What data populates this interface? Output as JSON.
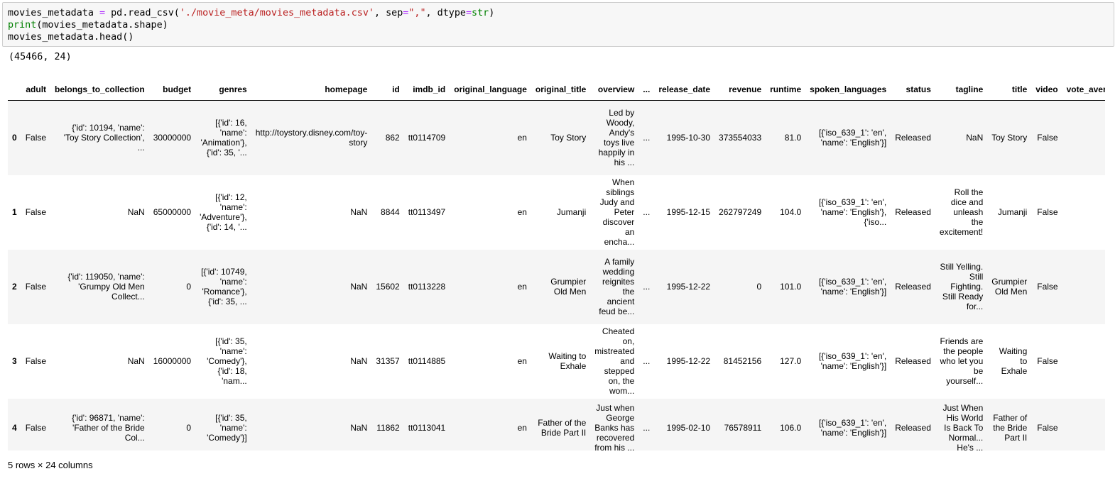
{
  "code_cell": {
    "line1": {
      "var": "movies_metadata ",
      "op": "=",
      "call": " pd.read_csv(",
      "path": "'./movie_meta/movies_metadata.csv'",
      "mid": ", sep",
      "op2": "=",
      "sep": "\",\"",
      "rest": ", dtype",
      "op3": "=",
      "dtype": "str",
      "close": ")"
    },
    "line2": {
      "fn": "print",
      "args": "(movies_metadata.shape)"
    },
    "line3": "movies_metadata.head()"
  },
  "stdout": "(45466, 24)",
  "columns": [
    "",
    "adult",
    "belongs_to_collection",
    "budget",
    "genres",
    "homepage",
    "id",
    "imdb_id",
    "original_language",
    "original_title",
    "overview",
    "...",
    "release_date",
    "revenue",
    "runtime",
    "spoken_languages",
    "status",
    "tagline",
    "title",
    "video",
    "vote_avera"
  ],
  "rows": [
    [
      "0",
      "False",
      "{'id': 10194, 'name': 'Toy Story Collection', ...",
      "30000000",
      "[{'id': 16, 'name': 'Animation'}, {'id': 35, '...",
      "http://toystory.disney.com/toy-story",
      "862",
      "tt0114709",
      "en",
      "Toy Story",
      "Led by Woody, Andy's toys live happily in his ...",
      "...",
      "1995-10-30",
      "373554033",
      "81.0",
      "[{'iso_639_1': 'en', 'name': 'English'}]",
      "Released",
      "NaN",
      "Toy Story",
      "False",
      ""
    ],
    [
      "1",
      "False",
      "NaN",
      "65000000",
      "[{'id': 12, 'name': 'Adventure'}, {'id': 14, '...",
      "NaN",
      "8844",
      "tt0113497",
      "en",
      "Jumanji",
      "When siblings Judy and Peter discover an encha...",
      "...",
      "1995-12-15",
      "262797249",
      "104.0",
      "[{'iso_639_1': 'en', 'name': 'English'}, {'iso...",
      "Released",
      "Roll the dice and unleash the excitement!",
      "Jumanji",
      "False",
      ""
    ],
    [
      "2",
      "False",
      "{'id': 119050, 'name': 'Grumpy Old Men Collect...",
      "0",
      "[{'id': 10749, 'name': 'Romance'}, {'id': 35, ...",
      "NaN",
      "15602",
      "tt0113228",
      "en",
      "Grumpier Old Men",
      "A family wedding reignites the ancient feud be...",
      "...",
      "1995-12-22",
      "0",
      "101.0",
      "[{'iso_639_1': 'en', 'name': 'English'}]",
      "Released",
      "Still Yelling. Still Fighting. Still Ready for...",
      "Grumpier Old Men",
      "False",
      ""
    ],
    [
      "3",
      "False",
      "NaN",
      "16000000",
      "[{'id': 35, 'name': 'Comedy'}, {'id': 18, 'nam...",
      "NaN",
      "31357",
      "tt0114885",
      "en",
      "Waiting to Exhale",
      "Cheated on, mistreated and stepped on, the wom...",
      "...",
      "1995-12-22",
      "81452156",
      "127.0",
      "[{'iso_639_1': 'en', 'name': 'English'}]",
      "Released",
      "Friends are the people who let you be yourself...",
      "Waiting to Exhale",
      "False",
      ""
    ],
    [
      "4",
      "False",
      "{'id': 96871, 'name': 'Father of the Bride Col...",
      "0",
      "[{'id': 35, 'name': 'Comedy'}]",
      "NaN",
      "11862",
      "tt0113041",
      "en",
      "Father of the Bride Part II",
      "Just when George Banks has recovered from his ...",
      "...",
      "1995-02-10",
      "76578911",
      "106.0",
      "[{'iso_639_1': 'en', 'name': 'English'}]",
      "Released",
      "Just When His World Is Back To Normal... He's ...",
      "Father of the Bride Part II",
      "False",
      ""
    ]
  ],
  "footer": "5 rows × 24 columns"
}
